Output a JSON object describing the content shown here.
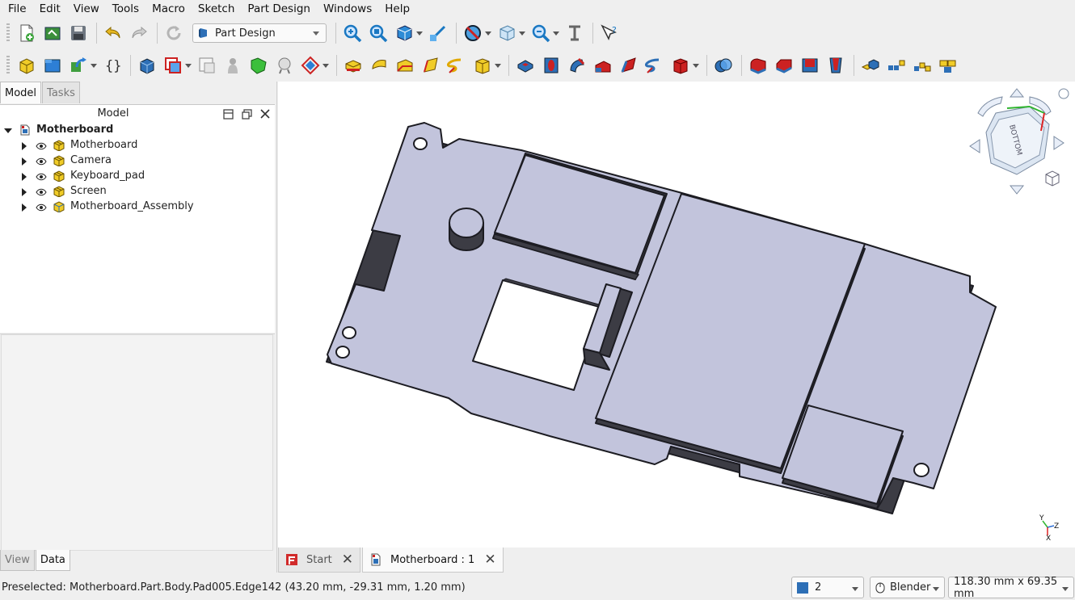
{
  "menu": [
    "File",
    "Edit",
    "View",
    "Tools",
    "Macro",
    "Sketch",
    "Part Design",
    "Windows",
    "Help"
  ],
  "toolbar1": {
    "workbench_selected": "Part Design",
    "icons": [
      "new-document-icon",
      "open-document-icon",
      "save-document-icon",
      "undo-icon",
      "redo-icon",
      "refresh-icon",
      "fit-all-icon",
      "fit-selection-icon",
      "std-views-icon",
      "measure-distance-icon",
      "draw-style-icon",
      "stereo-icon",
      "zoom-icon",
      "measure-tool-icon",
      "whats-this-icon"
    ]
  },
  "toolbar2": {
    "icons": [
      "create-body-icon",
      "create-part-icon",
      "create-link-icon",
      "create-group-icon",
      "shape-binder-icon",
      "clone-icon",
      "create-sketch-icon",
      "validate-sketch-icon",
      "attach-sketch-icon",
      "datum-point-icon",
      "pad-icon",
      "revolution-icon",
      "loft-icon",
      "pipe-icon",
      "helix-icon",
      "additive-primitive-icon",
      "pocket-icon",
      "hole-icon",
      "groove-icon",
      "subtractive-loft-icon",
      "subtractive-pipe-icon",
      "subtractive-helix-icon",
      "subtractive-primitive-icon",
      "boolean-icon",
      "fillet-icon",
      "chamfer-icon",
      "draft-icon",
      "thickness-icon",
      "mirrored-icon",
      "linear-pattern-icon",
      "polar-pattern-icon",
      "multi-transform-icon"
    ]
  },
  "panel": {
    "tabs": [
      "Model",
      "Tasks"
    ],
    "active_tab": "Model",
    "tree_title": "Model",
    "root": "Motherboard",
    "children": [
      "Motherboard",
      "Camera",
      "Keyboard_pad",
      "Screen",
      "Motherboard_Assembly"
    ],
    "bottom_tabs": [
      "View",
      "Data"
    ],
    "active_bottom_tab": "Data"
  },
  "doc_tabs": [
    {
      "label": "Start",
      "active": false
    },
    {
      "label": "Motherboard : 1",
      "active": true
    }
  ],
  "navcube": {
    "face_label": "BOTTOM"
  },
  "axes": {
    "x": "X",
    "y": "Y",
    "z": "Z"
  },
  "status": {
    "text": "Preselected: Motherboard.Part.Body.Pad005.Edge142 (43.20 mm, -29.31 mm, 1.20 mm)",
    "page": "2",
    "nav_style": "Blender",
    "dimensions": "118.30 mm x 69.35 mm"
  },
  "colors": {
    "part_face": "#c2c4dc",
    "part_side": "#4a4a52",
    "part_edge": "#1c1c22",
    "accent_blue": "#2d7fd6",
    "icon_yellow": "#e8c21a",
    "icon_red": "#d12b2b"
  }
}
